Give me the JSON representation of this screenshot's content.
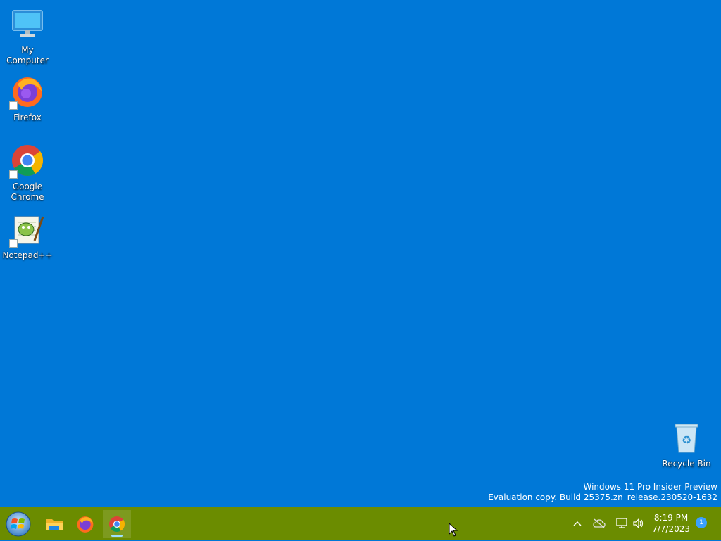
{
  "desktop": {
    "icons": [
      {
        "label": "My Computer",
        "icon": "computer-icon"
      },
      {
        "label": "Firefox",
        "icon": "firefox-icon"
      },
      {
        "label": "Google Chrome",
        "icon": "chrome-icon"
      },
      {
        "label": "Notepad++",
        "icon": "notepadpp-icon"
      },
      {
        "label": "Recycle Bin",
        "icon": "recycle-bin-icon"
      }
    ],
    "watermark": {
      "line1": "Windows 11 Pro Insider Preview",
      "line2": "Evaluation copy. Build 25375.zn_release.230520-1632"
    },
    "background_color": "#0078d7"
  },
  "taskbar": {
    "background_color": "#6b8c00",
    "start_icon": "windows-start-orb-icon",
    "apps": [
      {
        "name": "File Explorer",
        "icon": "file-explorer-icon",
        "active": false
      },
      {
        "name": "Firefox",
        "icon": "firefox-icon",
        "active": false
      },
      {
        "name": "Google Chrome",
        "icon": "chrome-icon",
        "active": true
      }
    ],
    "tray": {
      "icons": [
        "chevron-up-icon",
        "cloud-offline-icon",
        "network-icon",
        "volume-icon"
      ],
      "time": "8:19 PM",
      "date": "7/7/2023",
      "notification_count": "1"
    }
  }
}
